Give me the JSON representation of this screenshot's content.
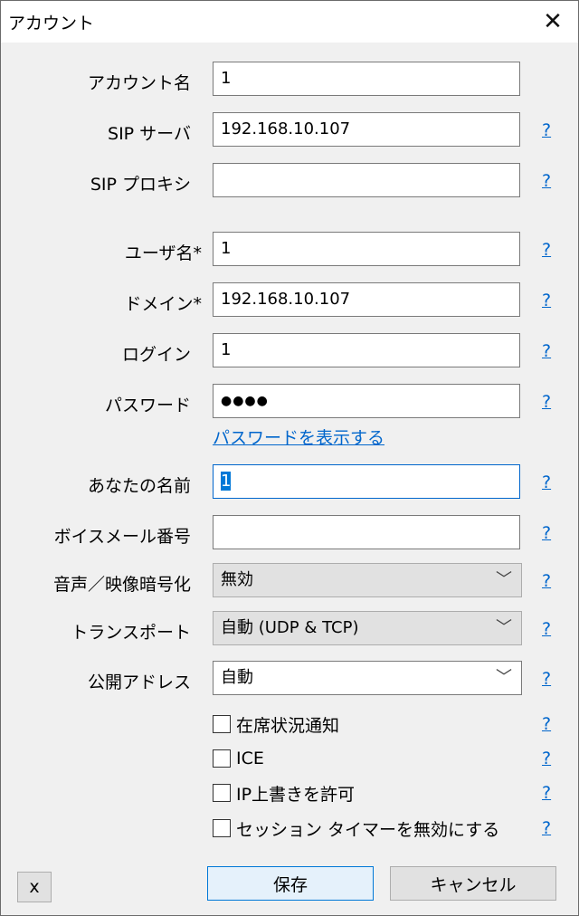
{
  "window": {
    "title": "アカウント",
    "close": "✕"
  },
  "fields": {
    "account_name": {
      "label": "アカウント名",
      "value": "1"
    },
    "sip_server": {
      "label": "SIP サーバ",
      "value": "192.168.10.107"
    },
    "sip_proxy": {
      "label": "SIP プロキシ",
      "value": ""
    },
    "user_name": {
      "label": "ユーザ名*",
      "value": "1"
    },
    "domain": {
      "label": "ドメイン*",
      "value": "192.168.10.107"
    },
    "login": {
      "label": "ログイン",
      "value": "1"
    },
    "password": {
      "label": "パスワード",
      "value": "●●●●"
    },
    "show_password": "パスワードを表示する",
    "display_name": {
      "label": "あなたの名前",
      "value": "1"
    },
    "voicemail": {
      "label": "ボイスメール番号",
      "value": ""
    },
    "encryption": {
      "label": "音声／映像暗号化",
      "value": "無効"
    },
    "transport": {
      "label": "トランスポート",
      "value": "自動 (UDP & TCP)"
    },
    "public_address": {
      "label": "公開アドレス",
      "value": "自動"
    }
  },
  "checkboxes": [
    {
      "label": "在席状況通知",
      "checked": false
    },
    {
      "label": "ICE",
      "checked": false
    },
    {
      "label": "IP上書きを許可",
      "checked": false
    },
    {
      "label": "セッション タイマーを無効にする",
      "checked": false
    }
  ],
  "help_glyph": "?",
  "chevron": "﹀",
  "buttons": {
    "x": "x",
    "save": "保存",
    "cancel": "キャンセル"
  }
}
